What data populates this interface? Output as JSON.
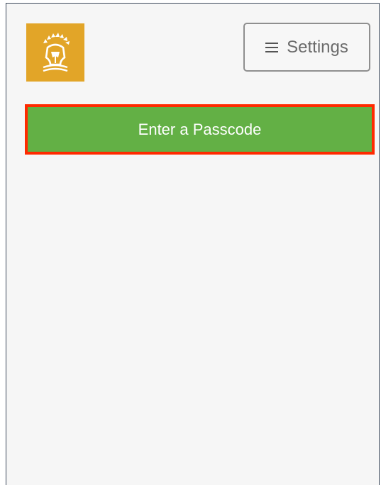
{
  "header": {
    "logo_icon": "spartan-helmet-logo-icon",
    "settings_label": "Settings",
    "settings_icon": "menu-icon"
  },
  "main": {
    "passcode_button_label": "Enter a Passcode"
  },
  "colors": {
    "logo_background": "#e2a528",
    "primary_button": "#63b045",
    "highlight_outline": "#ff2a00",
    "page_background": "#f6f6f6"
  }
}
